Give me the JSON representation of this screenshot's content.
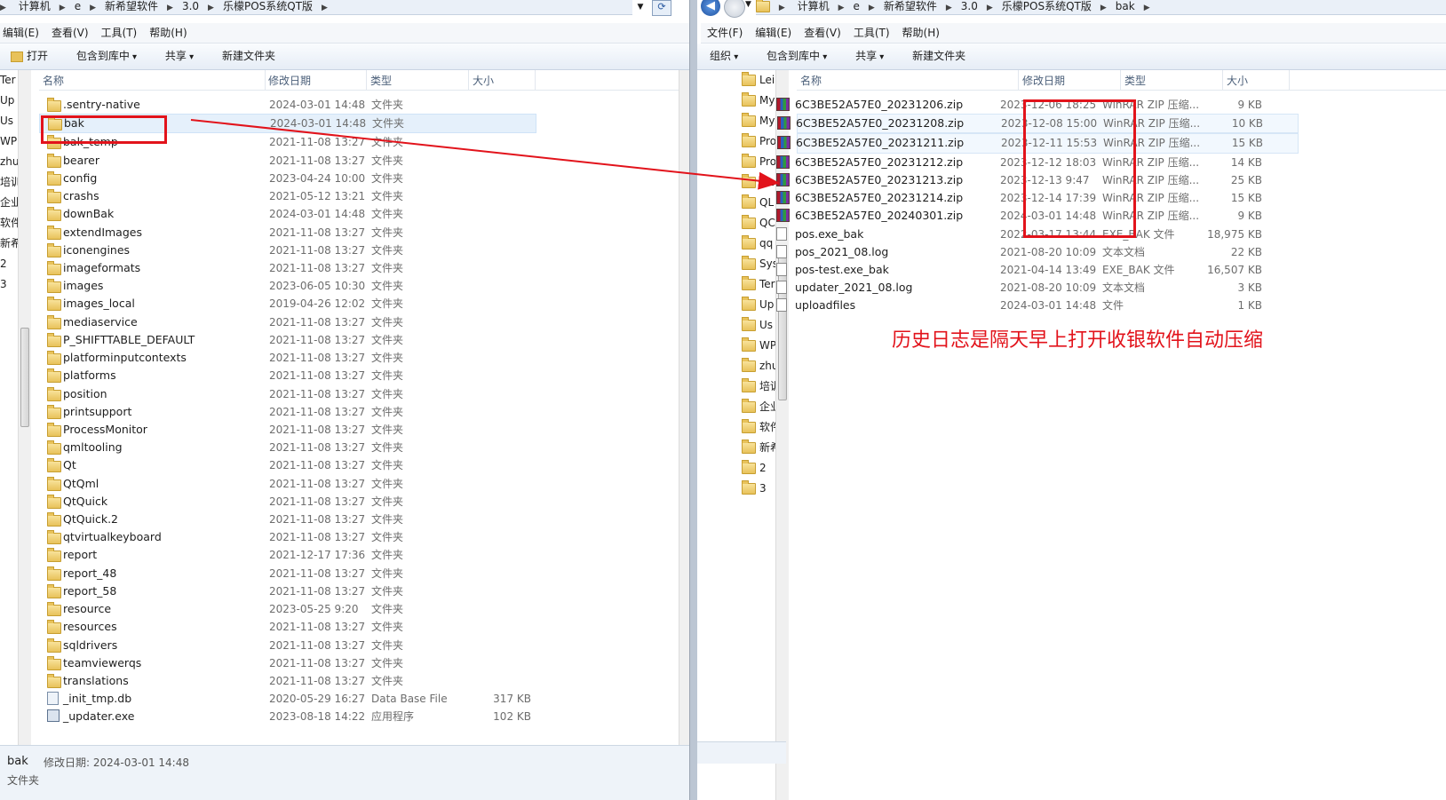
{
  "left": {
    "breadcrumb": [
      "计算机",
      "e",
      "新希望软件",
      "3.0",
      "乐檬POS系统QT版"
    ],
    "menu": [
      "编辑(E)",
      "查看(V)",
      "工具(T)",
      "帮助(H)"
    ],
    "toolbar": {
      "open": "打开",
      "include": "包含到库中",
      "share": "共享",
      "newfolder": "新建文件夹"
    },
    "columns": {
      "name": "名称",
      "date": "修改日期",
      "type": "类型",
      "size": "大小"
    },
    "nav": [
      "Ter",
      "Up",
      "Us",
      "WP",
      "zhu",
      "培训",
      "企业",
      "软件",
      "新希",
      "2",
      "3"
    ],
    "files": [
      {
        "name": ".sentry-native",
        "date": "2024-03-01 14:48",
        "type": "文件夹",
        "size": "",
        "icon": "folder"
      },
      {
        "name": "bak",
        "date": "2024-03-01 14:48",
        "type": "文件夹",
        "size": "",
        "icon": "folder"
      },
      {
        "name": "bak_temp",
        "date": "2021-11-08 13:27",
        "type": "文件夹",
        "size": "",
        "icon": "folder"
      },
      {
        "name": "bearer",
        "date": "2021-11-08 13:27",
        "type": "文件夹",
        "size": "",
        "icon": "folder"
      },
      {
        "name": "config",
        "date": "2023-04-24 10:00",
        "type": "文件夹",
        "size": "",
        "icon": "folder"
      },
      {
        "name": "crashs",
        "date": "2021-05-12 13:21",
        "type": "文件夹",
        "size": "",
        "icon": "folder"
      },
      {
        "name": "downBak",
        "date": "2024-03-01 14:48",
        "type": "文件夹",
        "size": "",
        "icon": "folder"
      },
      {
        "name": "extendImages",
        "date": "2021-11-08 13:27",
        "type": "文件夹",
        "size": "",
        "icon": "folder"
      },
      {
        "name": "iconengines",
        "date": "2021-11-08 13:27",
        "type": "文件夹",
        "size": "",
        "icon": "folder"
      },
      {
        "name": "imageformats",
        "date": "2021-11-08 13:27",
        "type": "文件夹",
        "size": "",
        "icon": "folder"
      },
      {
        "name": "images",
        "date": "2023-06-05 10:30",
        "type": "文件夹",
        "size": "",
        "icon": "folder"
      },
      {
        "name": "images_local",
        "date": "2019-04-26 12:02",
        "type": "文件夹",
        "size": "",
        "icon": "folder"
      },
      {
        "name": "mediaservice",
        "date": "2021-11-08 13:27",
        "type": "文件夹",
        "size": "",
        "icon": "folder"
      },
      {
        "name": "P_SHIFTTABLE_DEFAULT",
        "date": "2021-11-08 13:27",
        "type": "文件夹",
        "size": "",
        "icon": "folder"
      },
      {
        "name": "platforminputcontexts",
        "date": "2021-11-08 13:27",
        "type": "文件夹",
        "size": "",
        "icon": "folder"
      },
      {
        "name": "platforms",
        "date": "2021-11-08 13:27",
        "type": "文件夹",
        "size": "",
        "icon": "folder"
      },
      {
        "name": "position",
        "date": "2021-11-08 13:27",
        "type": "文件夹",
        "size": "",
        "icon": "folder"
      },
      {
        "name": "printsupport",
        "date": "2021-11-08 13:27",
        "type": "文件夹",
        "size": "",
        "icon": "folder"
      },
      {
        "name": "ProcessMonitor",
        "date": "2021-11-08 13:27",
        "type": "文件夹",
        "size": "",
        "icon": "folder"
      },
      {
        "name": "qmltooling",
        "date": "2021-11-08 13:27",
        "type": "文件夹",
        "size": "",
        "icon": "folder"
      },
      {
        "name": "Qt",
        "date": "2021-11-08 13:27",
        "type": "文件夹",
        "size": "",
        "icon": "folder"
      },
      {
        "name": "QtQml",
        "date": "2021-11-08 13:27",
        "type": "文件夹",
        "size": "",
        "icon": "folder"
      },
      {
        "name": "QtQuick",
        "date": "2021-11-08 13:27",
        "type": "文件夹",
        "size": "",
        "icon": "folder"
      },
      {
        "name": "QtQuick.2",
        "date": "2021-11-08 13:27",
        "type": "文件夹",
        "size": "",
        "icon": "folder"
      },
      {
        "name": "qtvirtualkeyboard",
        "date": "2021-11-08 13:27",
        "type": "文件夹",
        "size": "",
        "icon": "folder"
      },
      {
        "name": "report",
        "date": "2021-12-17 17:36",
        "type": "文件夹",
        "size": "",
        "icon": "folder"
      },
      {
        "name": "report_48",
        "date": "2021-11-08 13:27",
        "type": "文件夹",
        "size": "",
        "icon": "folder"
      },
      {
        "name": "report_58",
        "date": "2021-11-08 13:27",
        "type": "文件夹",
        "size": "",
        "icon": "folder"
      },
      {
        "name": "resource",
        "date": "2023-05-25 9:20",
        "type": "文件夹",
        "size": "",
        "icon": "folder"
      },
      {
        "name": "resources",
        "date": "2021-11-08 13:27",
        "type": "文件夹",
        "size": "",
        "icon": "folder"
      },
      {
        "name": "sqldrivers",
        "date": "2021-11-08 13:27",
        "type": "文件夹",
        "size": "",
        "icon": "folder"
      },
      {
        "name": "teamviewerqs",
        "date": "2021-11-08 13:27",
        "type": "文件夹",
        "size": "",
        "icon": "folder"
      },
      {
        "name": "translations",
        "date": "2021-11-08 13:27",
        "type": "文件夹",
        "size": "",
        "icon": "folder"
      },
      {
        "name": "_init_tmp.db",
        "date": "2020-05-29 16:27",
        "type": "Data Base File",
        "size": "317 KB",
        "icon": "db"
      },
      {
        "name": "_updater.exe",
        "date": "2023-08-18 14:22",
        "type": "应用程序",
        "size": "102 KB",
        "icon": "exe"
      }
    ],
    "status": {
      "name": "bak",
      "date_label": "修改日期: 2024-03-01 14:48",
      "type": "文件夹"
    }
  },
  "right": {
    "breadcrumb": [
      "计算机",
      "e",
      "新希望软件",
      "3.0",
      "乐檬POS系统QT版",
      "bak"
    ],
    "menu": [
      "文件(F)",
      "编辑(E)",
      "查看(V)",
      "工具(T)",
      "帮助(H)"
    ],
    "toolbar": {
      "organize": "组织",
      "include": "包含到库中",
      "share": "共享",
      "newfolder": "新建文件夹"
    },
    "columns": {
      "name": "名称",
      "date": "修改日期",
      "type": "类型",
      "size": "大小"
    },
    "nav": [
      "Lei",
      "My",
      "My",
      "Pro",
      "Pro",
      "QL",
      "QL",
      "QC",
      "qq",
      "Sys",
      "Ter",
      "Up",
      "Us",
      "WP",
      "zhu",
      "培训",
      "企业",
      "软件",
      "新希",
      "2",
      "3"
    ],
    "files": [
      {
        "name": "6C3BE52A57E0_20231206.zip",
        "date": "2023-12-06 18:25",
        "type": "WinRAR ZIP 压缩...",
        "size": "9 KB",
        "icon": "zip"
      },
      {
        "name": "6C3BE52A57E0_20231208.zip",
        "date": "2023-12-08 15:00",
        "type": "WinRAR ZIP 压缩...",
        "size": "10 KB",
        "icon": "zip"
      },
      {
        "name": "6C3BE52A57E0_20231211.zip",
        "date": "2023-12-11 15:53",
        "type": "WinRAR ZIP 压缩...",
        "size": "15 KB",
        "icon": "zip"
      },
      {
        "name": "6C3BE52A57E0_20231212.zip",
        "date": "2023-12-12 18:03",
        "type": "WinRAR ZIP 压缩...",
        "size": "14 KB",
        "icon": "zip"
      },
      {
        "name": "6C3BE52A57E0_20231213.zip",
        "date": "2023-12-13 9:47",
        "type": "WinRAR ZIP 压缩...",
        "size": "25 KB",
        "icon": "zip"
      },
      {
        "name": "6C3BE52A57E0_20231214.zip",
        "date": "2023-12-14 17:39",
        "type": "WinRAR ZIP 压缩...",
        "size": "15 KB",
        "icon": "zip"
      },
      {
        "name": "6C3BE52A57E0_20240301.zip",
        "date": "2024-03-01 14:48",
        "type": "WinRAR ZIP 压缩...",
        "size": "9 KB",
        "icon": "zip"
      },
      {
        "name": "pos.exe_bak",
        "date": "2022-03-17 13:44",
        "type": "EXE_BAK 文件",
        "size": "18,975 KB",
        "icon": "file"
      },
      {
        "name": "pos_2021_08.log",
        "date": "2021-08-20 10:09",
        "type": "文本文档",
        "size": "22 KB",
        "icon": "file"
      },
      {
        "name": "pos-test.exe_bak",
        "date": "2021-04-14 13:49",
        "type": "EXE_BAK 文件",
        "size": "16,507 KB",
        "icon": "file"
      },
      {
        "name": "updater_2021_08.log",
        "date": "2021-08-20 10:09",
        "type": "文本文档",
        "size": "3 KB",
        "icon": "file"
      },
      {
        "name": "uploadfiles",
        "date": "2024-03-01 14:48",
        "type": "文件",
        "size": "1 KB",
        "icon": "file"
      }
    ]
  },
  "annotation": {
    "note": "历史日志是隔天早上打开收银软件自动压缩",
    "color": "#e2131b"
  }
}
